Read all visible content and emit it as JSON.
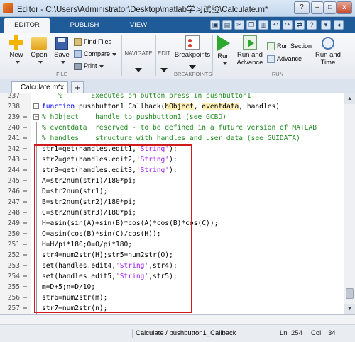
{
  "window": {
    "title": "Editor - C:\\Users\\Administrator\\Desktop\\matlab学习试验\\Calculate.m*",
    "controls": [
      "?",
      "–",
      "□",
      "x"
    ]
  },
  "toolstrip": {
    "tabs": [
      "EDITOR",
      "PUBLISH",
      "VIEW"
    ],
    "active_tab": "EDITOR"
  },
  "ribbon": {
    "file": {
      "new": "New",
      "open": "Open",
      "save": "Save",
      "find_files": "Find Files",
      "compare": "Compare",
      "print": "Print",
      "group_label": "FILE"
    },
    "navigate": {
      "label": "NAVIGATE"
    },
    "edit": {
      "label": "EDIT"
    },
    "breakpoints": {
      "button": "Breakpoints",
      "group_label": "BREAKPOINTS"
    },
    "run": {
      "run": "Run",
      "run_and_advance": [
        "Run and",
        "Advance"
      ],
      "run_section": "Run Section",
      "advance": "Advance",
      "run_and_time": [
        "Run and",
        "Time"
      ],
      "group_label": "RUN"
    }
  },
  "document_tabs": [
    {
      "label": "Calculate.m*",
      "close": "x"
    }
  ],
  "add_tab": "+",
  "editor": {
    "lines": [
      {
        "n": "237",
        "t": "    %       Executes on button press in pushbutton1."
      },
      {
        "n": "238",
        "t": "function pushbutton1_Callback(hObject, eventdata, handles)"
      },
      {
        "n": "239",
        "t": "% hObject    handle to pushbutton1 (see GCBO)"
      },
      {
        "n": "240",
        "t": "% eventdata  reserved - to be defined in a future version of MATLAB"
      },
      {
        "n": "241",
        "t": "% handles    structure with handles and user data (see GUIDATA)"
      },
      {
        "n": "242",
        "t": "str1=get(handles.edit1,'String');"
      },
      {
        "n": "243",
        "t": "str2=get(handles.edit2,'String');"
      },
      {
        "n": "244",
        "t": "str3=get(handles.edit3,'String');"
      },
      {
        "n": "245",
        "t": "A=str2num(str1)/180*pi;"
      },
      {
        "n": "246",
        "t": "D=str2num(str1);"
      },
      {
        "n": "247",
        "t": "B=str2num(str2)/180*pi;"
      },
      {
        "n": "248",
        "t": "C=str2num(str3)/180*pi;"
      },
      {
        "n": "249",
        "t": "H=asin(sin(A)+sin(B)*cos(A)*cos(B)*cos(C));"
      },
      {
        "n": "250",
        "t": "O=asin(cos(B)*sin(C)/cos(H));"
      },
      {
        "n": "251",
        "t": "H=H/pi*180;O=O/pi*180;"
      },
      {
        "n": "252",
        "t": "str4=num2str(H);str5=num2str(O);"
      },
      {
        "n": "253",
        "t": "set(handles.edit4,'String',str4);"
      },
      {
        "n": "254",
        "t": "set(handles.edit5,'String',str5);"
      },
      {
        "n": "255",
        "t": "m=D+5;n=D/10;"
      },
      {
        "n": "256",
        "t": "str6=num2str(m);"
      },
      {
        "n": "257",
        "t": "str7=num2str(n);"
      }
    ]
  },
  "status": {
    "function": "Calculate / pushbutton1_Callback",
    "ln_label": "Ln",
    "ln": "254",
    "col_label": "Col",
    "col": "34"
  }
}
